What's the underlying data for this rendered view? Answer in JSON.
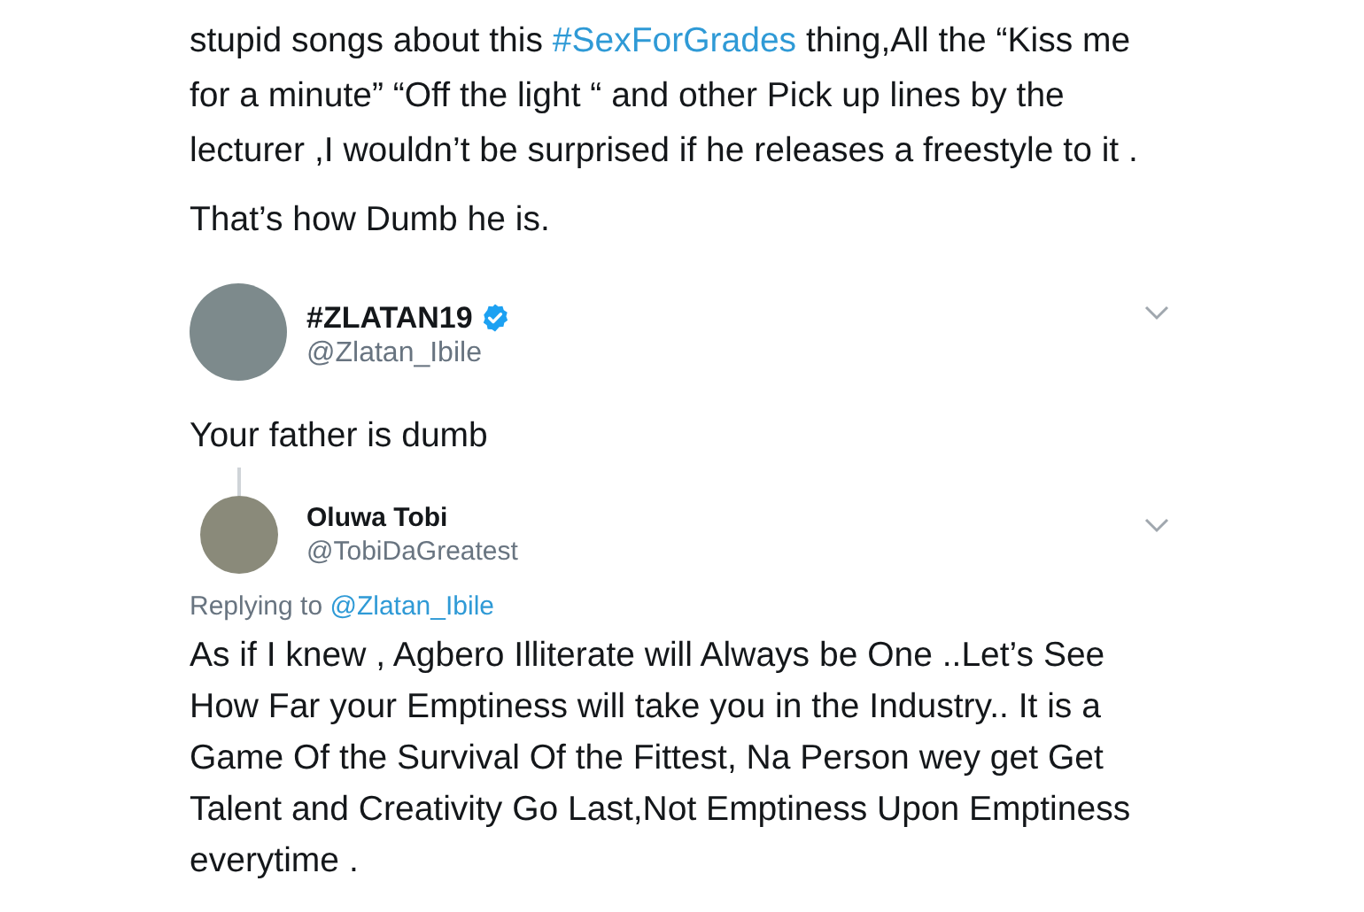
{
  "original_tweet": {
    "paragraphs": [
      [
        {
          "kind": "text",
          "text": "stupid songs about this "
        },
        {
          "kind": "hashtag",
          "text": "#SexForGrades"
        },
        {
          "kind": "text",
          "text": "  thing,All the “Kiss me for a minute” “Off the light “ and other Pick up lines by the lecturer ,I wouldn’t be surprised if he releases a freestyle to it ."
        }
      ],
      [
        {
          "kind": "text",
          "text": "That’s how Dumb he is."
        }
      ]
    ]
  },
  "replies": [
    {
      "name": "#ZLATAN19",
      "verified": true,
      "handle": "@Zlatan_Ibile",
      "text": "Your father is dumb",
      "thread_line": true
    },
    {
      "name": "Oluwa Tobi",
      "verified": false,
      "handle": "@TobiDaGreatest",
      "replying_to": {
        "label": "Replying to",
        "handle": "@Zlatan_Ibile"
      },
      "text": "As if I knew , Agbero Illiterate will Always be One ..Let’s See How Far your Emptiness will take you in the Industry.. It is a Game Of the Survival Of the Fittest, Na Person wey get Get Talent and Creativity Go Last,Not Emptiness Upon Emptiness everytime .",
      "thread_line": false
    }
  ]
}
